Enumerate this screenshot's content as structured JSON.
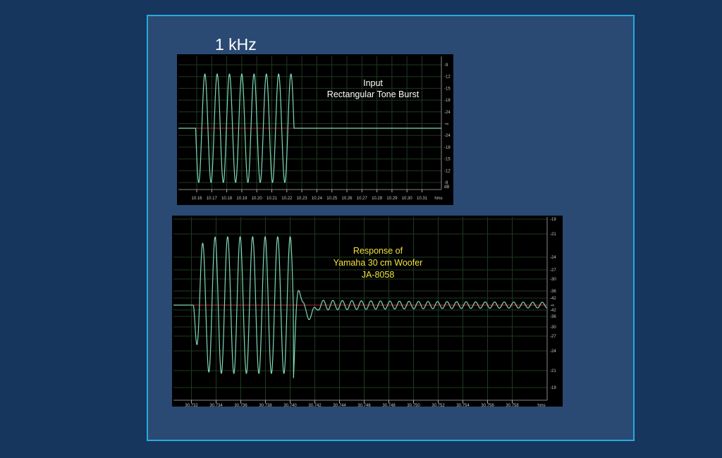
{
  "slide_title": "1 kHz",
  "chart_data": [
    {
      "type": "line",
      "annotation": [
        "Input",
        "Rectangular Tone Burst"
      ],
      "annotation_color": "#ffffff",
      "line_color": "#7ed9b8",
      "x_tick_labels": [
        "10.16",
        "10.17",
        "10.18",
        "10.19",
        "10.20",
        "10.21",
        "10.22",
        "10.23",
        "10.24",
        "10.25",
        "10.26",
        "10.27",
        "10.28",
        "10.29",
        "10.30",
        "10.31"
      ],
      "x_unit": "hms",
      "y_tick_labels": [
        "-9",
        "-12",
        "-15",
        "-18",
        "-24",
        "-∞",
        "-24",
        "-18",
        "-15",
        "-12",
        "-9"
      ],
      "y_unit": "dB",
      "burst": {
        "cycles": 8,
        "start_tick": 10.162,
        "end_tick": 10.2225,
        "amplitude_fraction": 0.93
      },
      "grid": true
    },
    {
      "type": "line",
      "annotation": [
        "Response of",
        "Yamaha 30 cm Woofer",
        "JA-8058"
      ],
      "annotation_color": "#f3e23c",
      "line_color": "#7ed9b8",
      "x_tick_labels": [
        "30.732",
        "30.734",
        "30.736",
        "30.738",
        "30.740",
        "30.742",
        "30.744",
        "30.746",
        "30.748",
        "30.750",
        "30.752",
        "30.754",
        "30.756",
        "30.758"
      ],
      "x_unit": "hms",
      "y_tick_labels": [
        "-19",
        "-21",
        "-24",
        "-27",
        "-30",
        "-36",
        "-42",
        "-∞",
        "-42",
        "-36",
        "-30",
        "-27",
        "-24",
        "-21",
        "-19"
      ],
      "grid": true
    }
  ]
}
